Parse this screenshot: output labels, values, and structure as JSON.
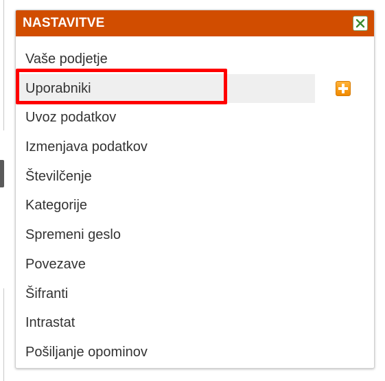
{
  "panel": {
    "title": "NASTAVITVE",
    "close_icon": "close-icon",
    "header_color": "#d14d00"
  },
  "menu": {
    "items": [
      {
        "label": "Vaše podjetje"
      },
      {
        "label": "Uporabniki"
      },
      {
        "label": "Uvoz podatkov"
      },
      {
        "label": "Izmenjava podatkov"
      },
      {
        "label": "Številčenje"
      },
      {
        "label": "Kategorije"
      },
      {
        "label": "Spremeni geslo"
      },
      {
        "label": "Povezave"
      },
      {
        "label": "Šifranti"
      },
      {
        "label": "Intrastat"
      },
      {
        "label": "Pošiljanje opominov"
      }
    ],
    "active_item": "Uporabniki",
    "add_icon": "plus-icon",
    "highlight_color": "#ff0000"
  }
}
